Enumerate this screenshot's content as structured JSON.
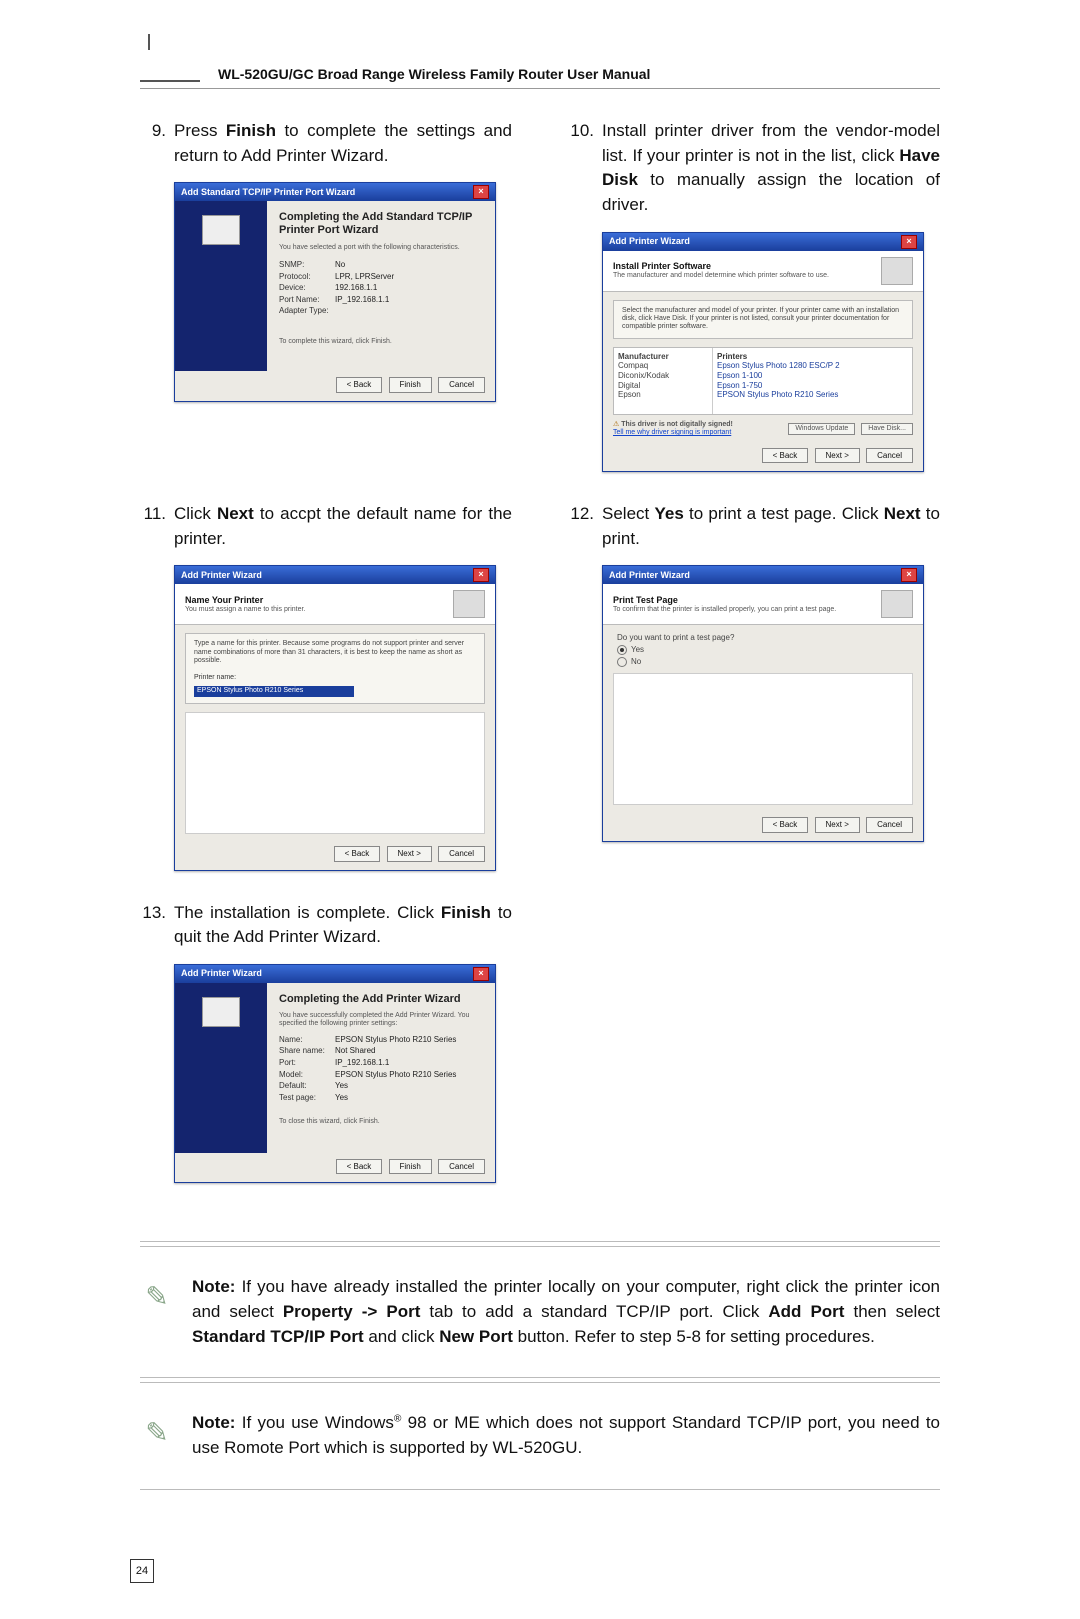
{
  "header": {
    "title": "WL-520GU/GC Broad Range Wireless Family Router User Manual"
  },
  "steps": {
    "s9": {
      "num": "9.",
      "text_a": "Press ",
      "b1": "Finish",
      "text_b": " to complete the settings and return to Add Printer Wizard."
    },
    "s10": {
      "num": "10.",
      "text_a": "Install printer driver from the vendor-model list. If your printer is not in the list, click ",
      "b1": "Have Disk",
      "text_b": " to manually assign the location of driver."
    },
    "s11": {
      "num": "11.",
      "text_a": "Click ",
      "b1": "Next",
      "text_b": " to accpt the default name for the printer."
    },
    "s12": {
      "num": "12.",
      "text_a": "Select ",
      "b1": "Yes",
      "text_b": " to print a test page. Click ",
      "b2": "Next",
      "text_c": " to print."
    },
    "s13": {
      "num": "13.",
      "text_a": "The installation is complete. Click ",
      "b1": "Finish",
      "text_b": " to quit the Add Printer Wizard."
    }
  },
  "dlg9": {
    "title": "Add Standard TCP/IP Printer Port Wizard",
    "heading": "Completing the Add Standard TCP/IP Printer Port Wizard",
    "subtitle": "You have selected a port with the following characteristics.",
    "rows": {
      "SNMP": "No",
      "Protocol": "LPR, LPRServer",
      "Device": "192.168.1.1",
      "Port Name": "IP_192.168.1.1",
      "Adapter Type": ""
    },
    "footer": "To complete this wizard, click Finish.",
    "btnBack": "< Back",
    "btnFinish": "Finish",
    "btnCancel": "Cancel"
  },
  "dlg10": {
    "title": "Add Printer Wizard",
    "heading": "Install Printer Software",
    "sub": "The manufacturer and model determine which printer software to use.",
    "panelText": "Select the manufacturer and model of your printer. If your printer came with an installation disk, click Have Disk. If your printer is not listed, consult your printer documentation for compatible printer software.",
    "mfrHeader": "Manufacturer",
    "prnHeader": "Printers",
    "mfrs": [
      "Compaq",
      "Diconix/Kodak",
      "Digital",
      "Epson"
    ],
    "printers": [
      "Epson Stylus Photo 1280 ESC/P 2",
      "Epson 1-100",
      "Epson 1-750",
      "EPSON Stylus Photo R210 Series"
    ],
    "signText": "This driver is not digitally signed!",
    "signLink": "Tell me why driver signing is important",
    "btnWU": "Windows Update",
    "btnHD": "Have Disk...",
    "btnBack": "< Back",
    "btnNext": "Next >",
    "btnCancel": "Cancel"
  },
  "dlg11": {
    "title": "Add Printer Wizard",
    "heading": "Name Your Printer",
    "sub": "You must assign a name to this printer.",
    "panelText": "Type a name for this printer. Because some programs do not support printer and server name combinations of more than 31 characters, it is best to keep the name as short as possible.",
    "fieldLabel": "Printer name:",
    "fieldValue": "EPSON Stylus Photo R210 Series",
    "btnBack": "< Back",
    "btnNext": "Next >",
    "btnCancel": "Cancel"
  },
  "dlg12": {
    "title": "Add Printer Wizard",
    "heading": "Print Test Page",
    "sub": "To confirm that the printer is installed properly, you can print a test page.",
    "question": "Do you want to print a test page?",
    "optYes": "Yes",
    "optNo": "No",
    "btnBack": "< Back",
    "btnNext": "Next >",
    "btnCancel": "Cancel"
  },
  "dlg13": {
    "title": "Add Printer Wizard",
    "heading": "Completing the Add Printer Wizard",
    "sub": "You have successfully completed the Add Printer Wizard. You specified the following printer settings:",
    "rows": {
      "Name:": "EPSON Stylus Photo R210 Series",
      "Share name:": "Not Shared",
      "Port:": "IP_192.168.1.1",
      "Model:": "EPSON Stylus Photo R210 Series",
      "Default:": "Yes",
      "Test page:": "Yes"
    },
    "footer": "To close this wizard, click Finish.",
    "btnBack": "< Back",
    "btnFinish": "Finish",
    "btnCancel": "Cancel"
  },
  "notes": {
    "n1": {
      "lead": "Note:",
      "a": " If you have already installed the printer locally on your computer, right click the printer icon and select ",
      "b1": "Property -> Port",
      "b": " tab to add a standard TCP/IP port. Click ",
      "b2": "Add Port",
      "c": " then select ",
      "b3": "Standard TCP/IP Port",
      "d": " and click ",
      "b4": "New Port",
      "e": " button. Refer to step 5-8 for setting procedures."
    },
    "n2": {
      "lead": "Note:",
      "a": " If you use Windows",
      "sup": "®",
      "b": " 98 or ME which does not support Standard TCP/IP port, you need to use Romote Port which is supported by WL-520GU."
    }
  },
  "pageNumber": "24"
}
